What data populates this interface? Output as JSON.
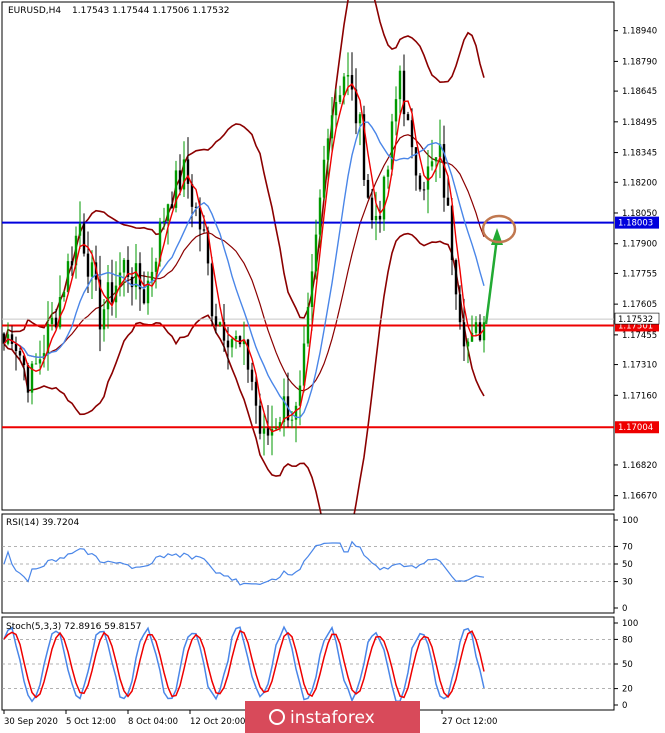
{
  "main": {
    "symbol": "EURUSD,H4",
    "ohlc": "1.17543 1.17544 1.17506 1.17532",
    "price_ticks": [
      "1.18940",
      "1.18790",
      "1.18645",
      "1.18495",
      "1.18345",
      "1.18200",
      "1.18050",
      "1.17900",
      "1.17755",
      "1.17605",
      "1.17455",
      "1.17310",
      "1.17160",
      "1.16820",
      "1.16670"
    ],
    "price_min": 1.166,
    "price_max": 1.1908,
    "levels": [
      {
        "label": "1.18003",
        "value": 1.18003,
        "color": "#0000dd"
      },
      {
        "label": "1.17501",
        "value": 1.17501,
        "color": "#ee0000"
      },
      {
        "label": "1.17004",
        "value": 1.17004,
        "color": "#ee0000"
      }
    ],
    "current_price": {
      "label": "1.17532",
      "value": 1.17532
    }
  },
  "rsi": {
    "title": "RSI(14) 39.7204",
    "ticks": [
      "100",
      "70",
      "50",
      "30",
      "0"
    ],
    "levels": [
      70,
      50,
      30
    ],
    "color": "#4a86e8"
  },
  "stoch": {
    "title": "Stoch(5,3,3) 72.8916 59.8157",
    "ticks": [
      "100",
      "80",
      "50",
      "20",
      "0"
    ],
    "levels": [
      80,
      50,
      20
    ],
    "main_color": "#4a86e8",
    "signal_color": "#ee0000"
  },
  "time_labels": [
    "30 Sep 2020",
    "5 Oct 12:00",
    "8 Oct 04:00",
    "12 Oct 20:00",
    "27 Oct 12:00"
  ],
  "watermark": "instaforex",
  "colors": {
    "bull": "#009900",
    "bear": "#000000",
    "bollinger": "#8b0000",
    "ma_fast": "#ee0000",
    "ma_slow": "#4a86e8",
    "arrow": "#22aa33",
    "circle": "#c07850"
  }
}
